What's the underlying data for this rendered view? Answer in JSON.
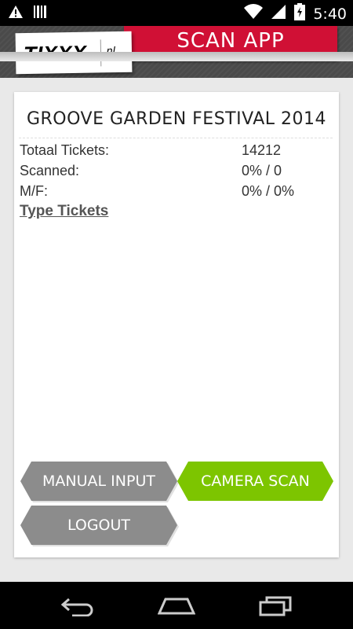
{
  "status_bar": {
    "time": "5:40",
    "icons": [
      "warning-icon",
      "barcode-icon",
      "wifi-icon",
      "signal-icon",
      "battery-charging-icon"
    ]
  },
  "header": {
    "logo_main": "TIXXX",
    "logo_sub": ".nl",
    "title": "SCAN APP",
    "accent_color": "#d01035"
  },
  "event": {
    "title": "GROOVE GARDEN FESTIVAL 2014",
    "stats": [
      {
        "label": "Totaal Tickets:",
        "value": "14212"
      },
      {
        "label": "Scanned:",
        "value": "0% / 0"
      },
      {
        "label": "M/F:",
        "value": "0% / 0%"
      }
    ],
    "type_tickets_link": "Type Tickets"
  },
  "buttons": {
    "manual_input": "MANUAL INPUT",
    "camera_scan": "CAMERA SCAN",
    "logout": "LOGOUT",
    "gray_color": "#8c8c8c",
    "green_color": "#7dc500"
  },
  "nav_bar": {
    "icons": [
      "back-icon",
      "home-icon",
      "recent-apps-icon"
    ]
  }
}
